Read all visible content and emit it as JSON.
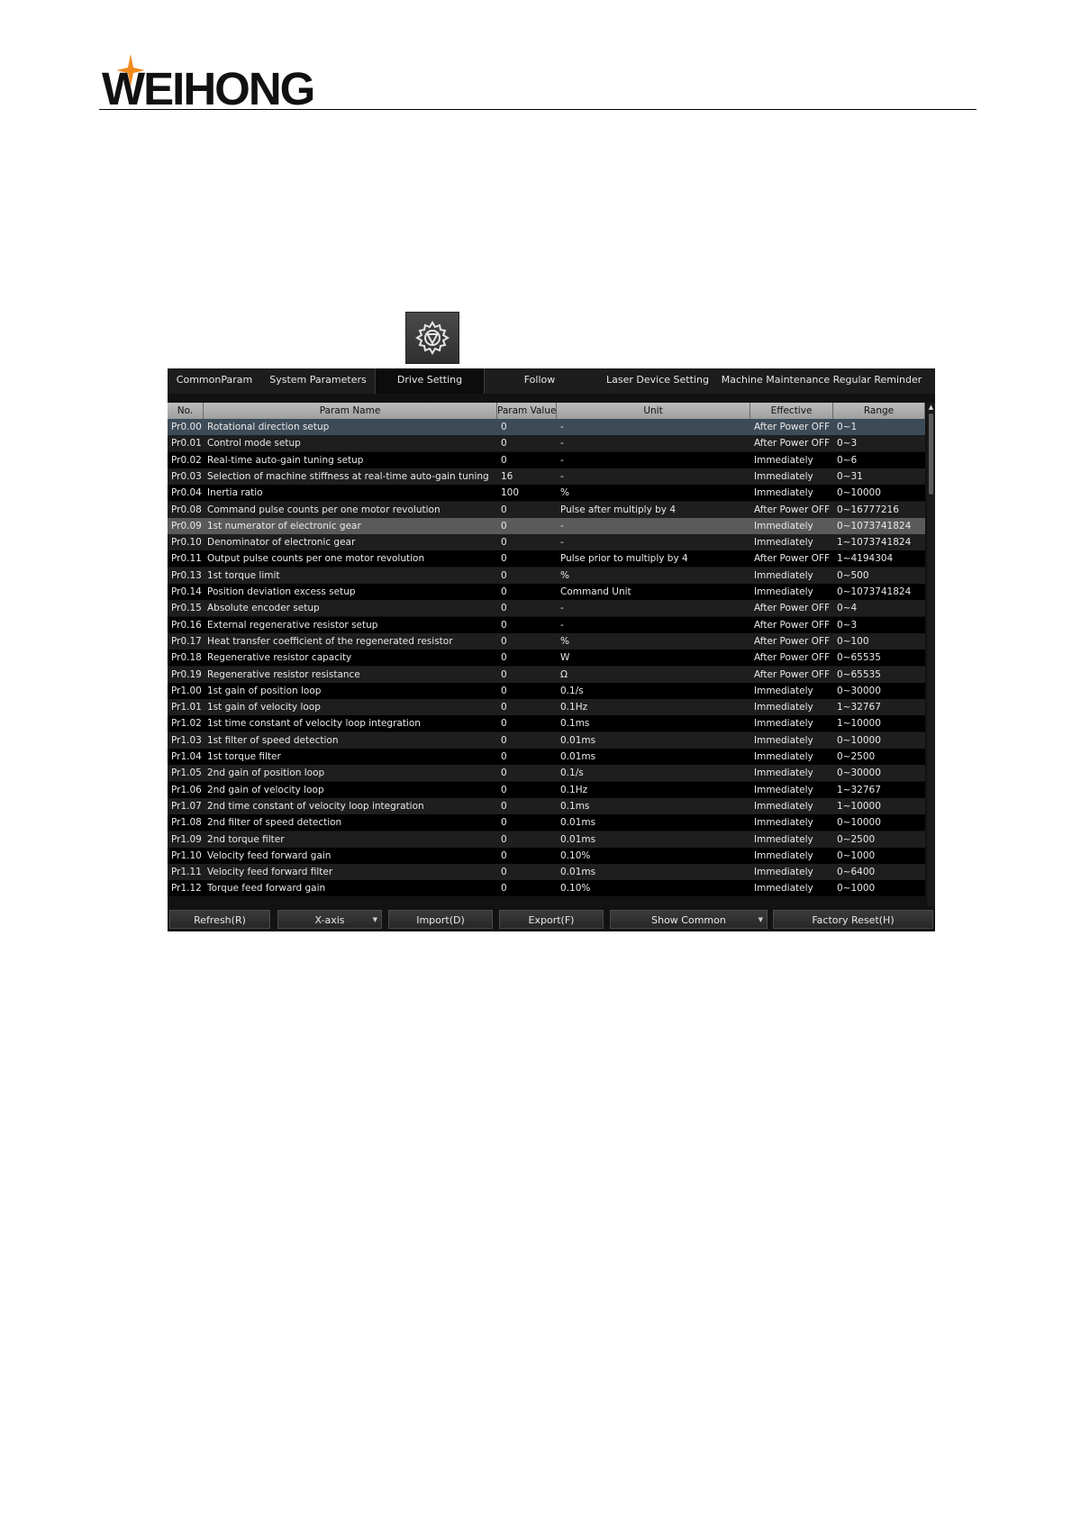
{
  "brand": {
    "name": "WEIHONG",
    "colors": {
      "text": "#111111",
      "star": "#f08a1c"
    }
  },
  "gear_icon": "gear-icon",
  "tabs": [
    {
      "label": "CommonParam",
      "active": false
    },
    {
      "label": "System Parameters",
      "active": false
    },
    {
      "label": "Drive Setting",
      "active": true
    },
    {
      "label": "Follow",
      "active": false
    },
    {
      "label": "Laser Device Setting",
      "active": false
    },
    {
      "label": "Machine Maintenance Regular Reminder",
      "active": false
    }
  ],
  "table": {
    "headers": [
      "No.",
      "Param Name",
      "Param Value",
      "Unit",
      "Effective",
      "Range"
    ],
    "rows": [
      [
        "Pr0.00",
        "Rotational direction setup",
        "0",
        "-",
        "After Power OFF",
        "0~1"
      ],
      [
        "Pr0.01",
        "Control mode setup",
        "0",
        "-",
        "After Power OFF",
        "0~3"
      ],
      [
        "Pr0.02",
        "Real-time auto-gain tuning setup",
        "0",
        "-",
        "Immediately",
        "0~6"
      ],
      [
        "Pr0.03",
        "Selection of machine stiffness at real-time auto-gain tuning",
        "16",
        "-",
        "Immediately",
        "0~31"
      ],
      [
        "Pr0.04",
        "Inertia ratio",
        "100",
        "%",
        "Immediately",
        "0~10000"
      ],
      [
        "Pr0.08",
        "Command pulse counts per one motor revolution",
        "0",
        "Pulse after multiply by 4",
        "After Power OFF",
        "0~16777216"
      ],
      [
        "Pr0.09",
        "1st numerator of electronic gear",
        "0",
        "-",
        "Immediately",
        "0~1073741824"
      ],
      [
        "Pr0.10",
        "Denominator of electronic gear",
        "0",
        "-",
        "Immediately",
        "1~1073741824"
      ],
      [
        "Pr0.11",
        "Output pulse counts per one motor revolution",
        "0",
        "Pulse prior to multiply by 4",
        "After Power OFF",
        "1~4194304"
      ],
      [
        "Pr0.13",
        "1st torque limit",
        "0",
        "%",
        "Immediately",
        "0~500"
      ],
      [
        "Pr0.14",
        "Position deviation excess setup",
        "0",
        "Command Unit",
        "Immediately",
        "0~1073741824"
      ],
      [
        "Pr0.15",
        "Absolute encoder setup",
        "0",
        "-",
        "After Power OFF",
        "0~4"
      ],
      [
        "Pr0.16",
        "External regenerative resistor setup",
        "0",
        "-",
        "After Power OFF",
        "0~3"
      ],
      [
        "Pr0.17",
        "Heat transfer coefficient of the regenerated resistor",
        "0",
        "%",
        "After Power OFF",
        "0~100"
      ],
      [
        "Pr0.18",
        "Regenerative resistor capacity",
        "0",
        "W",
        "After Power OFF",
        "0~65535"
      ],
      [
        "Pr0.19",
        "Regenerative resistor resistance",
        "0",
        "Ω",
        "After Power OFF",
        "0~65535"
      ],
      [
        "Pr1.00",
        "1st gain of position loop",
        "0",
        "0.1/s",
        "Immediately",
        "0~30000"
      ],
      [
        "Pr1.01",
        "1st gain of velocity loop",
        "0",
        "0.1Hz",
        "Immediately",
        "1~32767"
      ],
      [
        "Pr1.02",
        "1st time constant of velocity loop integration",
        "0",
        "0.1ms",
        "Immediately",
        "1~10000"
      ],
      [
        "Pr1.03",
        "1st filter of speed detection",
        "0",
        "0.01ms",
        "Immediately",
        "0~10000"
      ],
      [
        "Pr1.04",
        "1st torque filter",
        "0",
        "0.01ms",
        "Immediately",
        "0~2500"
      ],
      [
        "Pr1.05",
        "2nd gain of position loop",
        "0",
        "0.1/s",
        "Immediately",
        "0~30000"
      ],
      [
        "Pr1.06",
        "2nd gain of velocity loop",
        "0",
        "0.1Hz",
        "Immediately",
        "1~32767"
      ],
      [
        "Pr1.07",
        "2nd time constant of velocity loop integration",
        "0",
        "0.1ms",
        "Immediately",
        "1~10000"
      ],
      [
        "Pr1.08",
        "2nd filter of speed detection",
        "0",
        "0.01ms",
        "Immediately",
        "0~10000"
      ],
      [
        "Pr1.09",
        "2nd torque filter",
        "0",
        "0.01ms",
        "Immediately",
        "0~2500"
      ],
      [
        "Pr1.10",
        "Velocity feed forward gain",
        "0",
        "0.10%",
        "Immediately",
        "0~1000"
      ],
      [
        "Pr1.11",
        "Velocity feed forward filter",
        "0",
        "0.01ms",
        "Immediately",
        "0~6400"
      ],
      [
        "Pr1.12",
        "Torque feed forward gain",
        "0",
        "0.10%",
        "Immediately",
        "0~1000"
      ]
    ],
    "selected_rows": [
      0,
      6
    ]
  },
  "buttons": [
    {
      "label": "Refresh(R)",
      "dropdown": false
    },
    {
      "label": "X-axis",
      "dropdown": true
    },
    {
      "label": "Import(D)",
      "dropdown": false
    },
    {
      "label": "Export(F)",
      "dropdown": false
    },
    {
      "label": "Show Common",
      "dropdown": true
    },
    {
      "label": "Factory Reset(H)",
      "dropdown": false
    }
  ]
}
